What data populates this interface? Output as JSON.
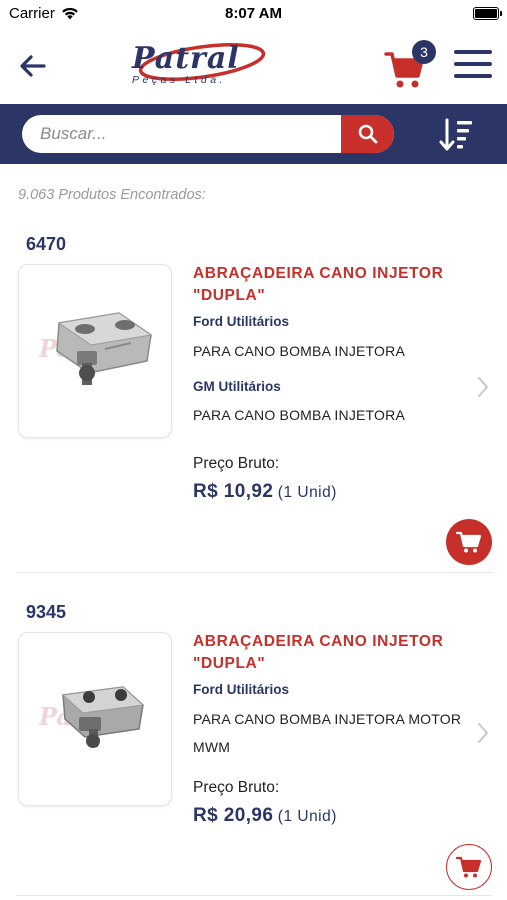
{
  "status_bar": {
    "carrier": "Carrier",
    "time": "8:07 AM"
  },
  "header": {
    "logo_text": "Patral",
    "logo_subtext": "Peças Ltda.",
    "cart_count": "3"
  },
  "search": {
    "placeholder": "Buscar..."
  },
  "results": {
    "count_text": "9.063 Produtos Encontrados:"
  },
  "products": [
    {
      "code": "6470",
      "name": "ABRAÇADEIRA CANO INJETOR \"DUPLA\"",
      "applications": [
        {
          "brand": "Ford Utilitários",
          "desc": "PARA CANO BOMBA INJETORA"
        },
        {
          "brand": "GM Utilitários",
          "desc": "PARA CANO BOMBA INJETORA"
        }
      ],
      "price_label": "Preço Bruto:",
      "price": "R$ 10,92",
      "unit": "(1 Unid)"
    },
    {
      "code": "9345",
      "name": "ABRAÇADEIRA CANO INJETOR \"DUPLA\"",
      "applications": [
        {
          "brand": "Ford Utilitários",
          "desc": "PARA CANO BOMBA INJETORA MOTOR MWM"
        }
      ],
      "price_label": "Preço Bruto:",
      "price": "R$ 20,96",
      "unit": "(1 Unid)"
    }
  ],
  "colors": {
    "navy": "#2b3666",
    "red": "#c62f2a",
    "muted": "#9a9a9a"
  },
  "icons": [
    "wifi-icon",
    "battery-icon",
    "back-arrow-icon",
    "cart-icon",
    "hamburger-menu-icon",
    "search-icon",
    "sort-icon",
    "chevron-right-icon",
    "add-to-cart-icon"
  ]
}
